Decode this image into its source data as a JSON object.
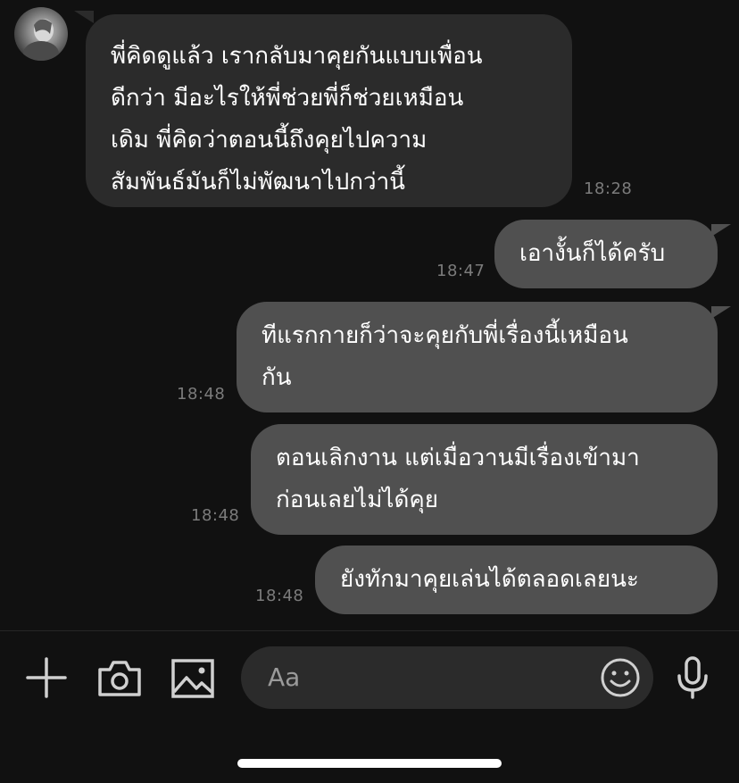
{
  "messages": [
    {
      "side": "incoming",
      "lines": [
        "พี่คิดดูแล้ว เรากลับมาคุยกันแบบเพื่อน",
        "ดีกว่า มีอะไรให้พี่ช่วยพี่ก็ช่วยเหมือน",
        "เดิม พี่คิดว่าตอนนี้ถึงคุยไปความ",
        "สัมพันธ์มันก็ไม่พัฒนาไปกว่านี้"
      ],
      "time": "18:28"
    },
    {
      "side": "outgoing",
      "lines": [
        "เอางั้นก็ได้ครับ"
      ],
      "time": "18:47"
    },
    {
      "side": "outgoing",
      "lines": [
        "ทีแรกกายก็ว่าจะคุยกับพี่เรื่องนี้เหมือน",
        "กัน"
      ],
      "time": "18:48"
    },
    {
      "side": "outgoing",
      "lines": [
        "ตอนเลิกงาน แต่เมื่อวานมีเรื่องเข้ามา",
        "ก่อนเลยไม่ได้คุย"
      ],
      "time": "18:48"
    },
    {
      "side": "outgoing",
      "lines": [
        "ยังทักมาคุยเล่นได้ตลอดเลยนะ"
      ],
      "time": "18:48"
    }
  ],
  "composer": {
    "placeholder": "Aa",
    "icons": [
      "plus-icon",
      "camera-icon",
      "image-icon",
      "emoji-icon",
      "microphone-icon"
    ]
  },
  "colors": {
    "background": "#111111",
    "incoming_bubble": "#2b2b2b",
    "outgoing_bubble": "#505050",
    "timestamp": "#7b7b7b"
  }
}
